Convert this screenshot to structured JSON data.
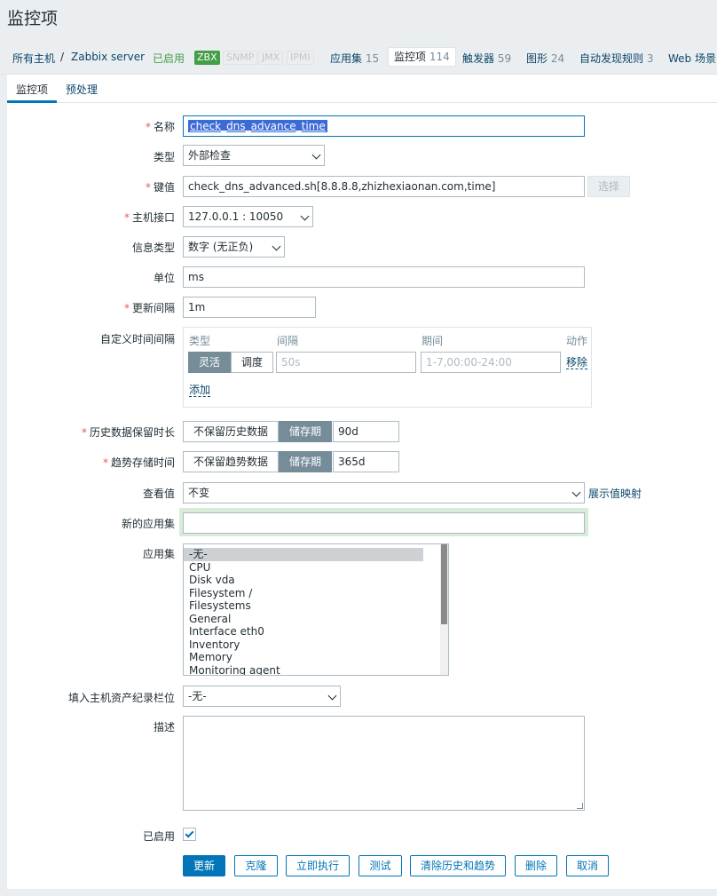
{
  "page": {
    "title": "监控项"
  },
  "breadcrumb": {
    "all_hosts": "所有主机",
    "separator": "/",
    "host": "Zabbix server",
    "status": "已启用",
    "tags": [
      "ZBX",
      "SNMP",
      "JMX",
      "IPMI"
    ],
    "links": [
      {
        "label": "应用集",
        "count": "15"
      },
      {
        "label": "监控项",
        "count": "114",
        "active": true
      },
      {
        "label": "触发器",
        "count": "59"
      },
      {
        "label": "图形",
        "count": "24"
      },
      {
        "label": "自动发现规则",
        "count": "3"
      },
      {
        "label": "Web 场景",
        "count": ""
      }
    ]
  },
  "tabs": [
    "监控项",
    "预处理"
  ],
  "form": {
    "name": {
      "label": "名称",
      "value": "check_dns_advance_time"
    },
    "type": {
      "label": "类型",
      "value": "外部检查"
    },
    "key": {
      "label": "键值",
      "value": "check_dns_advanced.sh[8.8.8.8,zhizhexiaonan.com,time]",
      "button": "选择"
    },
    "interface": {
      "label": "主机接口",
      "value": "127.0.0.1 : 10050"
    },
    "info_type": {
      "label": "信息类型",
      "value": "数字 (无正负)"
    },
    "units": {
      "label": "单位",
      "value": "ms"
    },
    "delay": {
      "label": "更新间隔",
      "value": "1m"
    },
    "custom_intervals": {
      "label": "自定义时间间隔",
      "headers": [
        "类型",
        "间隔",
        "期间",
        "动作"
      ],
      "mode_options": [
        "灵活",
        "调度"
      ],
      "interval_placeholder": "50s",
      "period_placeholder": "1-7,00:00-24:00",
      "remove": "移除",
      "add": "添加"
    },
    "history": {
      "label": "历史数据保留时长",
      "options": [
        "不保留历史数据",
        "储存期"
      ],
      "value": "90d"
    },
    "trends": {
      "label": "趋势存储时间",
      "options": [
        "不保留趋势数据",
        "储存期"
      ],
      "value": "365d"
    },
    "valuemap": {
      "label": "查看值",
      "value": "不变",
      "link": "展示值映射"
    },
    "new_application": {
      "label": "新的应用集",
      "value": ""
    },
    "applications": {
      "label": "应用集",
      "items": [
        "-无-",
        "CPU",
        "Disk vda",
        "Filesystem /",
        "Filesystems",
        "General",
        "Interface eth0",
        "Inventory",
        "Memory",
        "Monitoring agent"
      ]
    },
    "inventory": {
      "label": "填入主机资产纪录栏位",
      "value": "-无-"
    },
    "description": {
      "label": "描述",
      "value": ""
    },
    "enabled": {
      "label": "已启用",
      "checked": true
    }
  },
  "buttons": [
    "更新",
    "克隆",
    "立即执行",
    "测试",
    "清除历史和趋势",
    "删除",
    "取消"
  ],
  "colors": {
    "accent": "#0275b8",
    "enabled": "#429e47",
    "required": "#e45959"
  }
}
